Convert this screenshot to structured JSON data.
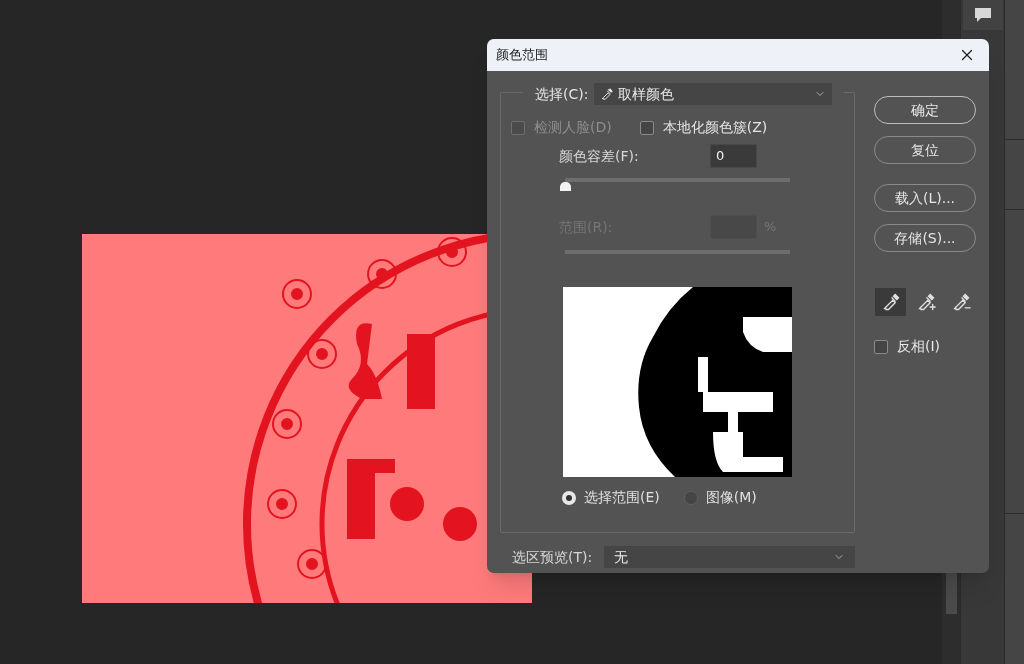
{
  "dialog": {
    "title": "颜色范围"
  },
  "select": {
    "label": "选择(C):",
    "value": "取样颜色"
  },
  "options": [
    {
      "label": "检测人脸(D)",
      "checked": false,
      "disabled": true
    },
    {
      "label": "本地化颜色簇(Z)",
      "checked": false,
      "disabled": false
    }
  ],
  "fuzziness": {
    "label": "颜色容差(F):",
    "value": "0",
    "level": 0
  },
  "range": {
    "label": "范围(R):",
    "unit": "%",
    "disabled": true
  },
  "view": [
    {
      "label": "选择范围(E)",
      "selected": true
    },
    {
      "label": "图像(M)",
      "selected": false
    }
  ],
  "selection_preview": {
    "label": "选区预览(T):",
    "value": "无"
  },
  "buttons": [
    "确定",
    "复位",
    "载入(L)...",
    "存储(S)..."
  ],
  "eyedroppers": [
    {
      "kind": "sample",
      "selected": true
    },
    {
      "kind": "add",
      "selected": false
    },
    {
      "kind": "subtract",
      "selected": false
    }
  ],
  "invert": {
    "label": "反相(I)",
    "checked": false
  }
}
